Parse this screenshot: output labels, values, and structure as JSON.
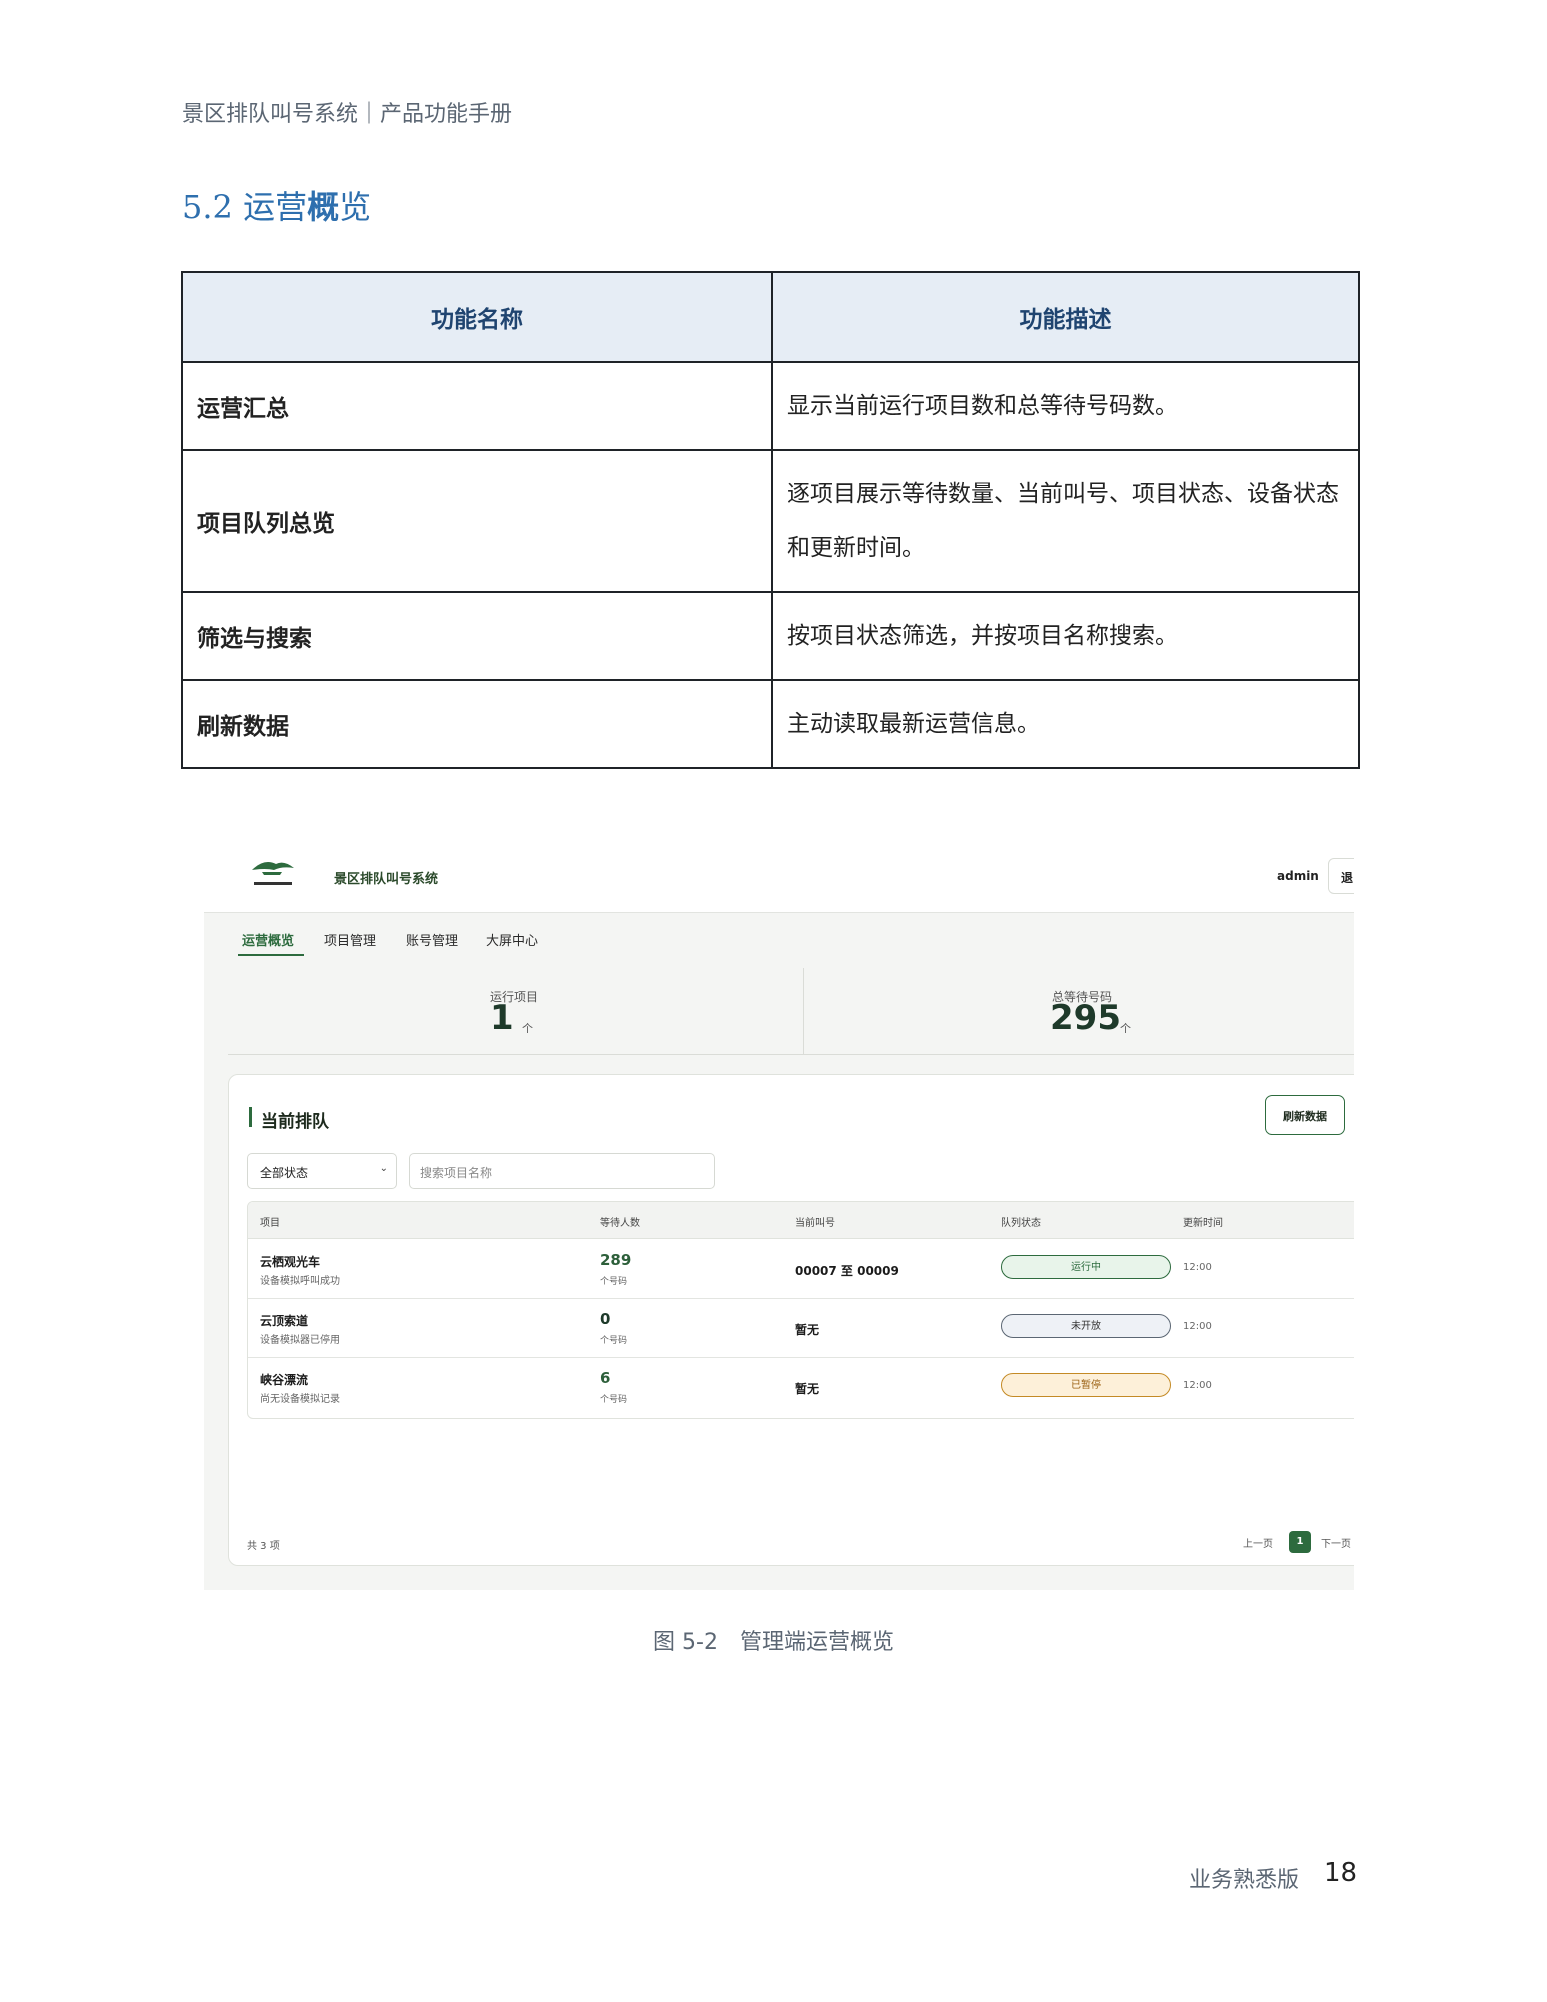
{
  "doc": {
    "header": "景区排队叫号系统｜产品功能手册",
    "section_number": "5.2",
    "section_title_a": "运营",
    "section_title_b": "概",
    "section_title_c": "览",
    "table": {
      "headers": [
        "功能名称",
        "功能描述"
      ],
      "rows": [
        {
          "name": "运营汇总",
          "desc": "显示当前运行项目数和总等待号码数。"
        },
        {
          "name": "项目队列总览",
          "desc": "逐项目展示等待数量、当前叫号、项目状态、设备状态和更新时间。"
        },
        {
          "name": "筛选与搜索",
          "desc": "按项目状态筛选，并按项目名称搜索。"
        },
        {
          "name": "刷新数据",
          "desc": "主动读取最新运营信息。"
        }
      ]
    },
    "caption": "图 5-2　管理端运营概览",
    "footer_label": "业务熟悉版",
    "page_number": "18"
  },
  "app": {
    "title": "景区排队叫号系统",
    "user": "admin",
    "logout_label": "退",
    "nav": [
      "运营概览",
      "项目管理",
      "账号管理",
      "大屏中心"
    ],
    "stats": [
      {
        "label": "运行项目",
        "value": "1",
        "unit": "个"
      },
      {
        "label": "总等待号码",
        "value": "295",
        "unit": "个"
      }
    ],
    "panel_title": "当前排队",
    "refresh_label": "刷新数据",
    "filter_value": "全部状态",
    "search_placeholder": "搜索项目名称",
    "columns": [
      "项目",
      "等待人数",
      "当前叫号",
      "队列状态",
      "更新时间"
    ],
    "rows": [
      {
        "name": "云栖观光车",
        "sub": "设备模拟呼叫成功",
        "waiting": "289",
        "unit": "个号码",
        "current": "00007 至 00009",
        "status": "运行中",
        "time": "12:00"
      },
      {
        "name": "云顶索道",
        "sub": "设备模拟器已停用",
        "waiting": "0",
        "unit": "个号码",
        "current": "暂无",
        "status": "未开放",
        "time": "12:00"
      },
      {
        "name": "峡谷漂流",
        "sub": "尚无设备模拟记录",
        "waiting": "6",
        "unit": "个号码",
        "current": "暂无",
        "status": "已暂停",
        "time": "12:00"
      }
    ],
    "total_text": "共 3 项",
    "pager": {
      "prev": "上一页",
      "current": "1",
      "next": "下一页"
    },
    "colors": {
      "accent": "#2d6b3e",
      "running": "#e8f4ea",
      "paused": "#fdf0d9",
      "closed": "#eef1f6"
    }
  }
}
